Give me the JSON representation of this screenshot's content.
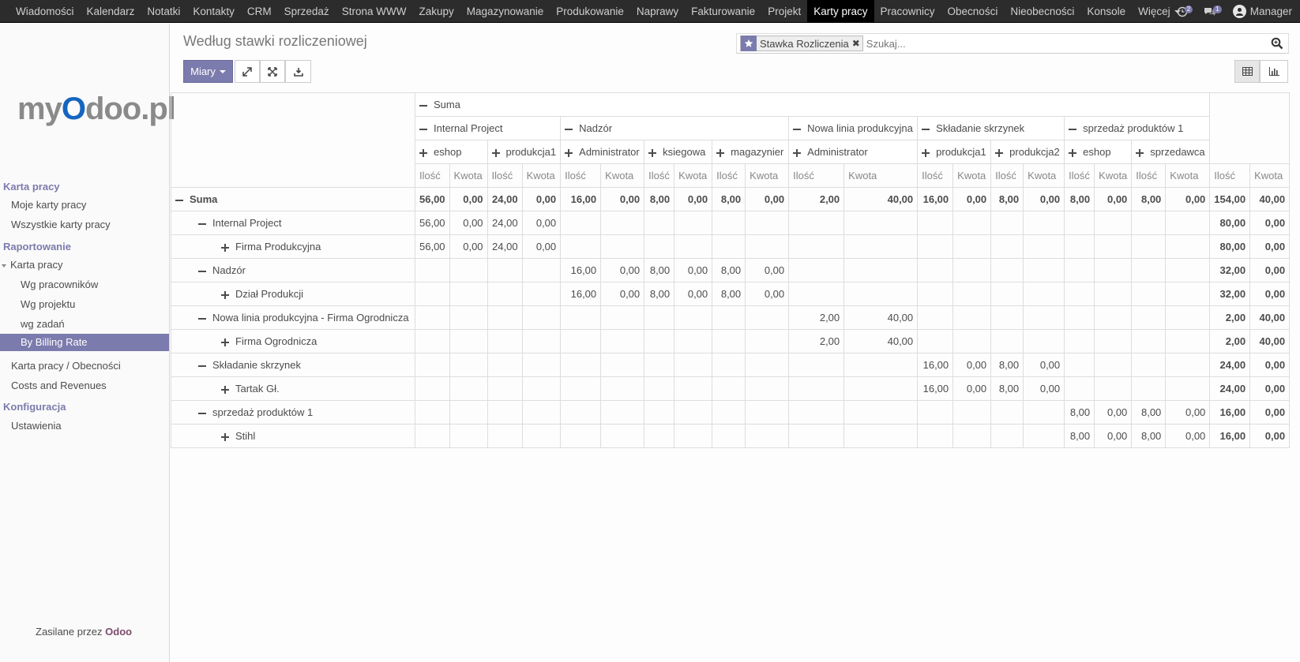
{
  "topnav": {
    "items": [
      "Wiadomości",
      "Kalendarz",
      "Notatki",
      "Kontakty",
      "CRM",
      "Sprzedaż",
      "Strona WWW",
      "Zakupy",
      "Magazynowanie",
      "Produkowanie",
      "Naprawy",
      "Fakturowanie",
      "Projekt",
      "Karty pracy",
      "Pracownicy",
      "Obecności",
      "Nieobecności",
      "Konsole",
      "Więcej"
    ],
    "active": "Karty pracy",
    "activity_count": "2",
    "message_count": "1",
    "user": "Manager"
  },
  "sidebar": {
    "logo": {
      "part1": "my",
      "part2": "O",
      "part3": "doo.pl"
    },
    "sections": [
      {
        "label": "Karta pracy"
      },
      {
        "label": "Raportowanie"
      },
      {
        "label": "Konfiguracja"
      }
    ],
    "links": {
      "moje": "Moje karty pracy",
      "wszystkie": "Wszystkie karty pracy",
      "karta_pracy": "Karta pracy",
      "wg_pracownikow": "Wg pracowników",
      "wg_projektu": "Wg projektu",
      "wg_zadan": "wg zadań",
      "by_billing_rate": "By Billing Rate",
      "karta_obecnosci": "Karta pracy / Obecności",
      "costs_revenues": "Costs and Revenues",
      "ustawienia": "Ustawienia"
    },
    "powered_prefix": "Zasilane przez",
    "powered_brand": "Odoo"
  },
  "control": {
    "title": "Według stawki rozliczeniowej",
    "facet": "Stawka Rozliczenia",
    "search_placeholder": "Szukaj...",
    "measures_label": "Miary"
  },
  "pivot": {
    "top_header": "Suma",
    "projects": [
      {
        "name": "Internal Project",
        "cols": [
          "eshop",
          "produkcja1"
        ]
      },
      {
        "name": "Nadzór",
        "cols": [
          "Administrator",
          "ksiegowa",
          "magazynier"
        ]
      },
      {
        "name": "Nowa linia produkcyjna",
        "cols": [
          "Administrator"
        ]
      },
      {
        "name": "Składanie skrzynek",
        "cols": [
          "produkcja1",
          "produkcja2"
        ]
      },
      {
        "name": "sprzedaż produktów 1",
        "cols": [
          "eshop",
          "sprzedawca"
        ]
      }
    ],
    "measures": [
      "Ilość",
      "Kwota"
    ],
    "rows": [
      {
        "label": "Suma",
        "level": 0,
        "icon": "minus",
        "total": true,
        "cells": [
          "56,00",
          "0,00",
          "24,00",
          "0,00",
          "16,00",
          "0,00",
          "8,00",
          "0,00",
          "8,00",
          "0,00",
          "2,00",
          "40,00",
          "16,00",
          "0,00",
          "8,00",
          "0,00",
          "8,00",
          "0,00",
          "8,00",
          "0,00",
          "154,00",
          "40,00"
        ]
      },
      {
        "label": "Internal Project",
        "level": 1,
        "icon": "minus",
        "cells": [
          "56,00",
          "0,00",
          "24,00",
          "0,00",
          "",
          "",
          "",
          "",
          "",
          "",
          "",
          "",
          "",
          "",
          "",
          "",
          "",
          "",
          "",
          "",
          "80,00",
          "0,00"
        ]
      },
      {
        "label": "Firma Produkcyjna",
        "level": 2,
        "icon": "plus",
        "cells": [
          "56,00",
          "0,00",
          "24,00",
          "0,00",
          "",
          "",
          "",
          "",
          "",
          "",
          "",
          "",
          "",
          "",
          "",
          "",
          "",
          "",
          "",
          "",
          "80,00",
          "0,00"
        ]
      },
      {
        "label": "Nadzór",
        "level": 1,
        "icon": "minus",
        "cells": [
          "",
          "",
          "",
          "",
          "16,00",
          "0,00",
          "8,00",
          "0,00",
          "8,00",
          "0,00",
          "",
          "",
          "",
          "",
          "",
          "",
          "",
          "",
          "",
          "",
          "32,00",
          "0,00"
        ]
      },
      {
        "label": "Dział Produkcji",
        "level": 2,
        "icon": "plus",
        "cells": [
          "",
          "",
          "",
          "",
          "16,00",
          "0,00",
          "8,00",
          "0,00",
          "8,00",
          "0,00",
          "",
          "",
          "",
          "",
          "",
          "",
          "",
          "",
          "",
          "",
          "32,00",
          "0,00"
        ]
      },
      {
        "label": "Nowa linia produkcyjna - Firma Ogrodnicza",
        "level": 1,
        "icon": "minus",
        "cells": [
          "",
          "",
          "",
          "",
          "",
          "",
          "",
          "",
          "",
          "",
          "2,00",
          "40,00",
          "",
          "",
          "",
          "",
          "",
          "",
          "",
          "",
          "2,00",
          "40,00"
        ]
      },
      {
        "label": "Firma Ogrodnicza",
        "level": 2,
        "icon": "plus",
        "cells": [
          "",
          "",
          "",
          "",
          "",
          "",
          "",
          "",
          "",
          "",
          "2,00",
          "40,00",
          "",
          "",
          "",
          "",
          "",
          "",
          "",
          "",
          "2,00",
          "40,00"
        ]
      },
      {
        "label": "Składanie skrzynek",
        "level": 1,
        "icon": "minus",
        "cells": [
          "",
          "",
          "",
          "",
          "",
          "",
          "",
          "",
          "",
          "",
          "",
          "",
          "16,00",
          "0,00",
          "8,00",
          "0,00",
          "",
          "",
          "",
          "",
          "24,00",
          "0,00"
        ]
      },
      {
        "label": "Tartak Gł.",
        "level": 2,
        "icon": "plus",
        "cells": [
          "",
          "",
          "",
          "",
          "",
          "",
          "",
          "",
          "",
          "",
          "",
          "",
          "16,00",
          "0,00",
          "8,00",
          "0,00",
          "",
          "",
          "",
          "",
          "24,00",
          "0,00"
        ]
      },
      {
        "label": "sprzedaż produktów 1",
        "level": 1,
        "icon": "minus",
        "cells": [
          "",
          "",
          "",
          "",
          "",
          "",
          "",
          "",
          "",
          "",
          "",
          "",
          "",
          "",
          "",
          "",
          "8,00",
          "0,00",
          "8,00",
          "0,00",
          "16,00",
          "0,00"
        ]
      },
      {
        "label": "Stihl",
        "level": 2,
        "icon": "plus",
        "cells": [
          "",
          "",
          "",
          "",
          "",
          "",
          "",
          "",
          "",
          "",
          "",
          "",
          "",
          "",
          "",
          "",
          "8,00",
          "0,00",
          "8,00",
          "0,00",
          "16,00",
          "0,00"
        ]
      }
    ]
  },
  "colors": {
    "accent": "#7c7bad",
    "topbar": "#2c2c2c",
    "active_nav": "#000000"
  }
}
